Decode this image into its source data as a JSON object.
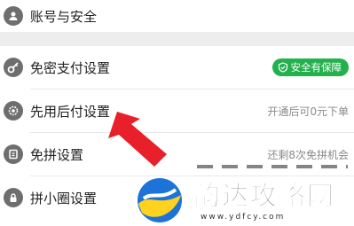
{
  "rows": [
    {
      "label": "账号与安全",
      "icon": "user-shield-icon"
    },
    {
      "label": "免密支付设置",
      "icon": "key-icon",
      "badge": "安全有保障"
    },
    {
      "label": "先用后付设置",
      "icon": "gear-badge-icon",
      "value": "开通后可0元下单"
    },
    {
      "label": "免拼设置",
      "icon": "ticket-icon",
      "value": "还剩8次免拼机会"
    },
    {
      "label": "拼小圈设置",
      "icon": "lock-icon"
    }
  ],
  "watermark": {
    "title": "韵达攻略网",
    "url": "www.ydfcy.com"
  },
  "colors": {
    "badge": "#22b14c",
    "arrow": "#e8202a",
    "icon": "#6e6e6e"
  }
}
